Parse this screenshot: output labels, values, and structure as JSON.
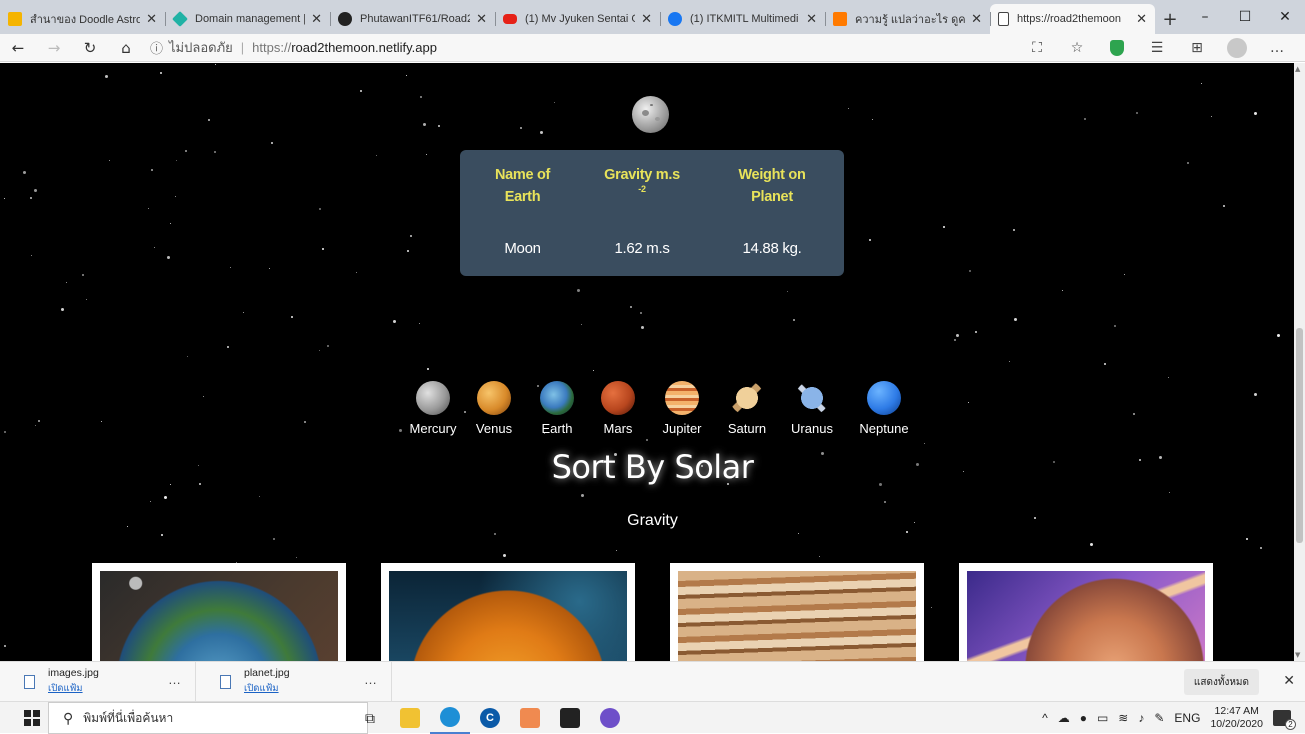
{
  "browser": {
    "tabs": [
      {
        "label": "สำนาของ Doodle Astro",
        "favicon_color": "#f5b400",
        "icon": "slides-icon"
      },
      {
        "label": "Domain management |",
        "favicon_color": "#20b2a5",
        "icon": "netlify-icon"
      },
      {
        "label": "PhutawanITF61/Road2",
        "favicon_color": "#222222",
        "icon": "github-icon"
      },
      {
        "label": "(1) Mv Jyuken Sentai G",
        "favicon_color": "#e62117",
        "icon": "youtube-icon"
      },
      {
        "label": "(1) ITKMITL Multimedi",
        "favicon_color": "#1877f2",
        "icon": "facebook-icon"
      },
      {
        "label": "ความรู้ แปลว่าอะไร ดูความ",
        "favicon_color": "#ff7a00",
        "icon": "dictionary-icon"
      },
      {
        "label": "https://road2themoon",
        "favicon_color": "#ffffff",
        "icon": "page-icon",
        "active": true
      }
    ],
    "new_tab": "+",
    "window_controls": {
      "minimize": "–",
      "maximize": "☐",
      "close": "✕"
    },
    "address": {
      "security_text": "ไม่ปลอดภัย",
      "separator": "|",
      "protocol": "https://",
      "host": "road2themoon.netlify.app"
    }
  },
  "page": {
    "info_card": {
      "headers": [
        {
          "line1": "Name of",
          "line2": "Earth"
        },
        {
          "line1": "Gravity m.s",
          "sup": "-2"
        },
        {
          "line1": "Weight on",
          "line2": "Planet"
        }
      ],
      "values": [
        "Moon",
        "1.62 m.s",
        "14.88 kg."
      ]
    },
    "planets": [
      {
        "name": "Mercury",
        "color": "#9a9a9a"
      },
      {
        "name": "Venus",
        "color": "#d88a2a"
      },
      {
        "name": "Earth",
        "color": "#3b7bbf"
      },
      {
        "name": "Mars",
        "color": "#b8461e"
      },
      {
        "name": "Jupiter",
        "color": "#d98c45"
      },
      {
        "name": "Saturn",
        "color": "#e0b272"
      },
      {
        "name": "Uranus",
        "color": "#5b8ecf"
      },
      {
        "name": "Neptune",
        "color": "#2e7be6"
      }
    ],
    "sort_title": "Sort By Solar",
    "sort_subtitle": "Gravity",
    "cards": [
      {
        "name": "earth-card"
      },
      {
        "name": "venus-card"
      },
      {
        "name": "jupiter-card"
      },
      {
        "name": "saturn-card"
      }
    ]
  },
  "downloads": {
    "items": [
      {
        "file": "images.jpg",
        "action": "เปิดแฟ้ม"
      },
      {
        "file": "planet.jpg",
        "action": "เปิดแฟ้ม"
      }
    ],
    "show_all": "แสดงทั้งหมด",
    "close": "✕"
  },
  "taskbar": {
    "search_placeholder": "พิมพ์ที่นี่เพื่อค้นหา",
    "language": "ENG",
    "time": "12:47 AM",
    "date": "10/20/2020",
    "notification_count": "2"
  }
}
